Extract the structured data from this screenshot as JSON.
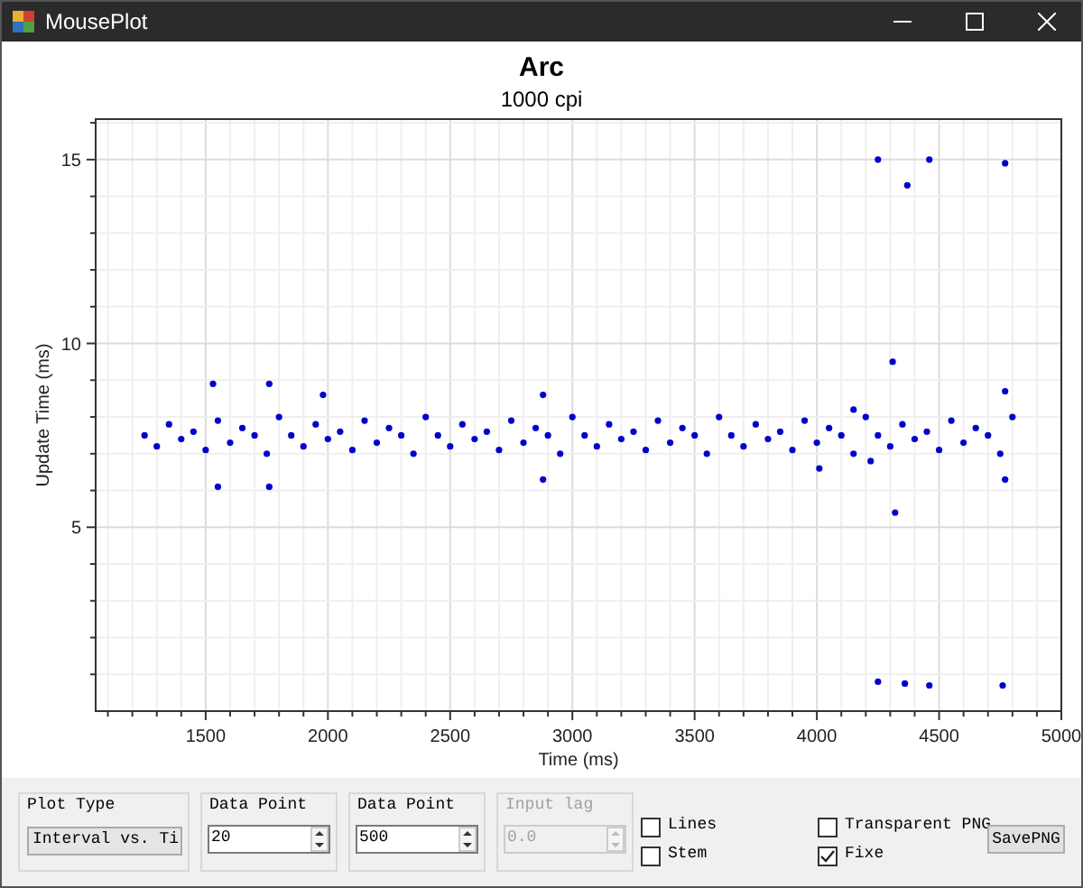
{
  "window": {
    "title": "MousePlot"
  },
  "chart": {
    "title": "Arc",
    "subtitle": "1000 cpi",
    "chart_data": {
      "type": "scatter",
      "xlabel": "Time (ms)",
      "ylabel": "Update Time (ms)",
      "xlim": [
        1050,
        5000
      ],
      "ylim": [
        0,
        16.1
      ],
      "grid": true,
      "xticks": [
        1500,
        2000,
        2500,
        3000,
        3500,
        4000,
        4500,
        5000
      ],
      "yticks": [
        5,
        10,
        15
      ],
      "x": [
        1250,
        1300,
        1350,
        1400,
        1450,
        1500,
        1550,
        1600,
        1650,
        1700,
        1750,
        1800,
        1850,
        1900,
        1950,
        2000,
        2050,
        2100,
        2150,
        2200,
        2250,
        2300,
        2350,
        2400,
        2450,
        2500,
        2550,
        2600,
        2650,
        2700,
        2750,
        2800,
        2850,
        2900,
        2950,
        3000,
        3050,
        3100,
        3150,
        3200,
        3250,
        3300,
        3350,
        3400,
        3450,
        3500,
        3550,
        3600,
        3650,
        3700,
        3750,
        3800,
        3850,
        3900,
        3950,
        4000,
        4050,
        4100,
        4150,
        4200,
        4250,
        4300,
        4350,
        4400,
        4450,
        4500,
        4550,
        4600,
        4650,
        4700,
        4750,
        4800,
        1530,
        1550,
        1760,
        1760,
        1980,
        2880,
        2880,
        4250,
        4370,
        4460,
        4770,
        4250,
        4360,
        4460,
        4760,
        4310,
        4320,
        4770,
        4770,
        4150,
        4010,
        4220
      ],
      "series": [
        {
          "color": "#0000cc",
          "values": [
            7.5,
            7.2,
            7.8,
            7.4,
            7.6,
            7.1,
            7.9,
            7.3,
            7.7,
            7.5,
            7.0,
            8.0,
            7.5,
            7.2,
            7.8,
            7.4,
            7.6,
            7.1,
            7.9,
            7.3,
            7.7,
            7.5,
            7.0,
            8.0,
            7.5,
            7.2,
            7.8,
            7.4,
            7.6,
            7.1,
            7.9,
            7.3,
            7.7,
            7.5,
            7.0,
            8.0,
            7.5,
            7.2,
            7.8,
            7.4,
            7.6,
            7.1,
            7.9,
            7.3,
            7.7,
            7.5,
            7.0,
            8.0,
            7.5,
            7.2,
            7.8,
            7.4,
            7.6,
            7.1,
            7.9,
            7.3,
            7.7,
            7.5,
            7.0,
            8.0,
            7.5,
            7.2,
            7.8,
            7.4,
            7.6,
            7.1,
            7.9,
            7.3,
            7.7,
            7.5,
            7.0,
            8.0,
            8.9,
            6.1,
            8.9,
            6.1,
            8.6,
            8.6,
            6.3,
            15.0,
            14.3,
            15.0,
            14.9,
            0.8,
            0.75,
            0.7,
            0.7,
            9.5,
            5.4,
            8.7,
            6.3,
            8.2,
            6.6,
            6.8
          ]
        }
      ]
    }
  },
  "controls": {
    "plot_type": {
      "label": "Plot Type",
      "value": "Interval vs. Ti"
    },
    "spinners": [
      {
        "label": "Data Point",
        "value": "20",
        "disabled": false
      },
      {
        "label": "Data Point",
        "value": "500",
        "disabled": false
      },
      {
        "label": "Input lag",
        "value": "0.0",
        "disabled": true
      }
    ],
    "checkboxes": [
      {
        "label": "Lines",
        "checked": false
      },
      {
        "label": "Stem",
        "checked": false
      },
      {
        "label": "Transparent PNG",
        "checked": false
      },
      {
        "label": "Fixe",
        "checked": true
      }
    ],
    "save_button": "SavePNG"
  }
}
